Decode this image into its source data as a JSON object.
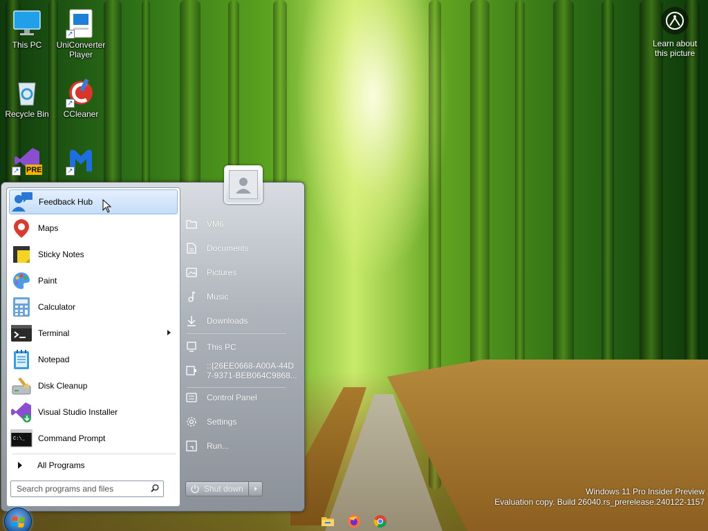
{
  "desktop": {
    "icons": [
      {
        "label": "This PC"
      },
      {
        "label": "UniConverter Player"
      },
      {
        "label": "Recycle Bin"
      },
      {
        "label": "CCleaner"
      },
      {
        "label": "",
        "badge": "PRE"
      },
      {
        "label": ""
      }
    ],
    "learn_label": "Learn about this picture",
    "watermark": {
      "line1": "Windows 11 Pro Insider Preview",
      "line2": "Evaluation copy. Build 26040.rs_prerelease.240122-1157"
    }
  },
  "start_menu": {
    "programs": [
      {
        "label": "Feedback Hub",
        "icon": "feedback-hub-icon",
        "highlighted": true
      },
      {
        "label": "Maps",
        "icon": "maps-icon"
      },
      {
        "label": "Sticky Notes",
        "icon": "sticky-notes-icon"
      },
      {
        "label": "Paint",
        "icon": "paint-icon"
      },
      {
        "label": "Calculator",
        "icon": "calculator-icon"
      },
      {
        "label": "Terminal",
        "icon": "terminal-icon",
        "submenu": true
      },
      {
        "label": "Notepad",
        "icon": "notepad-icon"
      },
      {
        "label": "Disk Cleanup",
        "icon": "disk-cleanup-icon"
      },
      {
        "label": "Visual Studio Installer",
        "icon": "visual-studio-installer-icon"
      },
      {
        "label": "Command Prompt",
        "icon": "command-prompt-icon"
      }
    ],
    "all_programs": "All Programs",
    "search_placeholder": "Search programs and files",
    "places": [
      {
        "label": "VM6",
        "icon": "folder-icon"
      },
      {
        "label": "Documents",
        "icon": "documents-icon"
      },
      {
        "label": "Pictures",
        "icon": "pictures-icon"
      },
      {
        "label": "Music",
        "icon": "music-icon"
      },
      {
        "label": "Downloads",
        "icon": "downloads-icon"
      },
      {
        "label": "This PC",
        "icon": "this-pc-icon"
      },
      {
        "label_line1": "::{26EE0668-A00A-44D",
        "label_line2": "7-9371-BEB064C9868...",
        "icon": "device-icon"
      },
      {
        "label": "Control Panel",
        "icon": "control-panel-icon"
      },
      {
        "label": "Settings",
        "icon": "settings-icon"
      },
      {
        "label": "Run...",
        "icon": "run-icon"
      }
    ],
    "shutdown_label": "Shut down"
  },
  "taskbar": {
    "apps": [
      "file-explorer-icon",
      "firefox-icon",
      "chrome-icon"
    ]
  }
}
